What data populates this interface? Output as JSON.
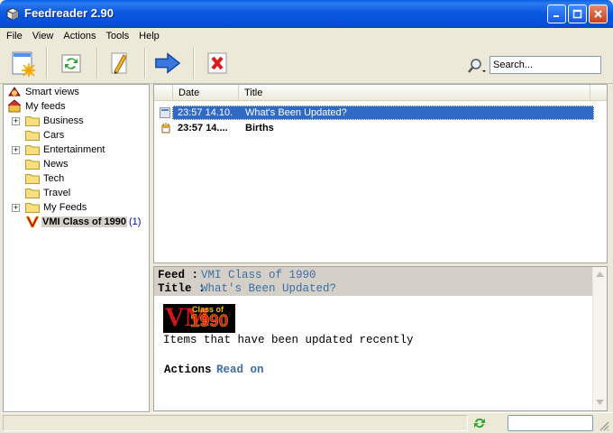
{
  "window": {
    "title": "Feedreader 2.90"
  },
  "menu": [
    "File",
    "View",
    "Actions",
    "Tools",
    "Help"
  ],
  "toolbar": {
    "buttons": [
      "new-feed-icon",
      "refresh-icon",
      "edit-icon",
      "next-arrow-icon",
      "delete-icon"
    ],
    "search_placeholder": "Search..."
  },
  "tree": {
    "smart_views": "Smart views",
    "my_feeds": "My feeds",
    "folders": [
      "Business",
      "Cars",
      "Entertainment",
      "News",
      "Tech",
      "Travel",
      "My Feeds"
    ],
    "selected_feed": {
      "label": "VMI Class of 1990",
      "count": "(1)"
    }
  },
  "list": {
    "columns": {
      "date": "Date",
      "title": "Title"
    },
    "rows": [
      {
        "date": "23:57 14.10.",
        "title": "What's Been Updated?"
      },
      {
        "date": "23:57 14....",
        "title": "Births"
      }
    ]
  },
  "content": {
    "feed_label": "Feed :",
    "feed_value": "VMI Class of 1990",
    "title_label": "Title :",
    "title_value": "What's Been Updated?",
    "logo_text": "Class of",
    "logo_year": "1990",
    "logo_letters": "VM",
    "description": "Items that have been updated recently",
    "actions_label": "Actions",
    "read_on": "Read on"
  },
  "colors": {
    "selection": "#316ac5",
    "link": "#3b6ea5",
    "titlebar": "#0a5fe3"
  }
}
